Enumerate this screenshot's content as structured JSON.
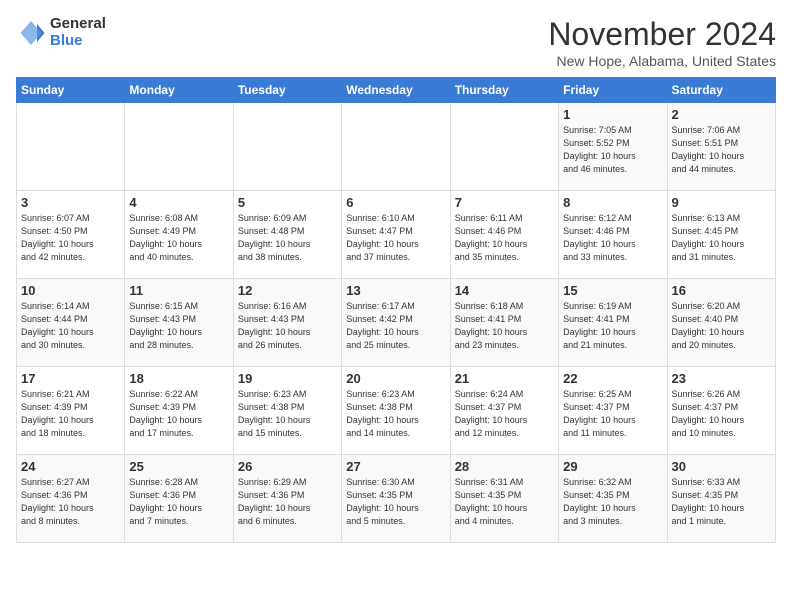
{
  "logo": {
    "general": "General",
    "blue": "Blue"
  },
  "title": "November 2024",
  "location": "New Hope, Alabama, United States",
  "days_of_week": [
    "Sunday",
    "Monday",
    "Tuesday",
    "Wednesday",
    "Thursday",
    "Friday",
    "Saturday"
  ],
  "weeks": [
    [
      {
        "day": "",
        "info": ""
      },
      {
        "day": "",
        "info": ""
      },
      {
        "day": "",
        "info": ""
      },
      {
        "day": "",
        "info": ""
      },
      {
        "day": "",
        "info": ""
      },
      {
        "day": "1",
        "info": "Sunrise: 7:05 AM\nSunset: 5:52 PM\nDaylight: 10 hours\nand 46 minutes."
      },
      {
        "day": "2",
        "info": "Sunrise: 7:06 AM\nSunset: 5:51 PM\nDaylight: 10 hours\nand 44 minutes."
      }
    ],
    [
      {
        "day": "3",
        "info": "Sunrise: 6:07 AM\nSunset: 4:50 PM\nDaylight: 10 hours\nand 42 minutes."
      },
      {
        "day": "4",
        "info": "Sunrise: 6:08 AM\nSunset: 4:49 PM\nDaylight: 10 hours\nand 40 minutes."
      },
      {
        "day": "5",
        "info": "Sunrise: 6:09 AM\nSunset: 4:48 PM\nDaylight: 10 hours\nand 38 minutes."
      },
      {
        "day": "6",
        "info": "Sunrise: 6:10 AM\nSunset: 4:47 PM\nDaylight: 10 hours\nand 37 minutes."
      },
      {
        "day": "7",
        "info": "Sunrise: 6:11 AM\nSunset: 4:46 PM\nDaylight: 10 hours\nand 35 minutes."
      },
      {
        "day": "8",
        "info": "Sunrise: 6:12 AM\nSunset: 4:46 PM\nDaylight: 10 hours\nand 33 minutes."
      },
      {
        "day": "9",
        "info": "Sunrise: 6:13 AM\nSunset: 4:45 PM\nDaylight: 10 hours\nand 31 minutes."
      }
    ],
    [
      {
        "day": "10",
        "info": "Sunrise: 6:14 AM\nSunset: 4:44 PM\nDaylight: 10 hours\nand 30 minutes."
      },
      {
        "day": "11",
        "info": "Sunrise: 6:15 AM\nSunset: 4:43 PM\nDaylight: 10 hours\nand 28 minutes."
      },
      {
        "day": "12",
        "info": "Sunrise: 6:16 AM\nSunset: 4:43 PM\nDaylight: 10 hours\nand 26 minutes."
      },
      {
        "day": "13",
        "info": "Sunrise: 6:17 AM\nSunset: 4:42 PM\nDaylight: 10 hours\nand 25 minutes."
      },
      {
        "day": "14",
        "info": "Sunrise: 6:18 AM\nSunset: 4:41 PM\nDaylight: 10 hours\nand 23 minutes."
      },
      {
        "day": "15",
        "info": "Sunrise: 6:19 AM\nSunset: 4:41 PM\nDaylight: 10 hours\nand 21 minutes."
      },
      {
        "day": "16",
        "info": "Sunrise: 6:20 AM\nSunset: 4:40 PM\nDaylight: 10 hours\nand 20 minutes."
      }
    ],
    [
      {
        "day": "17",
        "info": "Sunrise: 6:21 AM\nSunset: 4:39 PM\nDaylight: 10 hours\nand 18 minutes."
      },
      {
        "day": "18",
        "info": "Sunrise: 6:22 AM\nSunset: 4:39 PM\nDaylight: 10 hours\nand 17 minutes."
      },
      {
        "day": "19",
        "info": "Sunrise: 6:23 AM\nSunset: 4:38 PM\nDaylight: 10 hours\nand 15 minutes."
      },
      {
        "day": "20",
        "info": "Sunrise: 6:23 AM\nSunset: 4:38 PM\nDaylight: 10 hours\nand 14 minutes."
      },
      {
        "day": "21",
        "info": "Sunrise: 6:24 AM\nSunset: 4:37 PM\nDaylight: 10 hours\nand 12 minutes."
      },
      {
        "day": "22",
        "info": "Sunrise: 6:25 AM\nSunset: 4:37 PM\nDaylight: 10 hours\nand 11 minutes."
      },
      {
        "day": "23",
        "info": "Sunrise: 6:26 AM\nSunset: 4:37 PM\nDaylight: 10 hours\nand 10 minutes."
      }
    ],
    [
      {
        "day": "24",
        "info": "Sunrise: 6:27 AM\nSunset: 4:36 PM\nDaylight: 10 hours\nand 8 minutes."
      },
      {
        "day": "25",
        "info": "Sunrise: 6:28 AM\nSunset: 4:36 PM\nDaylight: 10 hours\nand 7 minutes."
      },
      {
        "day": "26",
        "info": "Sunrise: 6:29 AM\nSunset: 4:36 PM\nDaylight: 10 hours\nand 6 minutes."
      },
      {
        "day": "27",
        "info": "Sunrise: 6:30 AM\nSunset: 4:35 PM\nDaylight: 10 hours\nand 5 minutes."
      },
      {
        "day": "28",
        "info": "Sunrise: 6:31 AM\nSunset: 4:35 PM\nDaylight: 10 hours\nand 4 minutes."
      },
      {
        "day": "29",
        "info": "Sunrise: 6:32 AM\nSunset: 4:35 PM\nDaylight: 10 hours\nand 3 minutes."
      },
      {
        "day": "30",
        "info": "Sunrise: 6:33 AM\nSunset: 4:35 PM\nDaylight: 10 hours\nand 1 minute."
      }
    ]
  ]
}
